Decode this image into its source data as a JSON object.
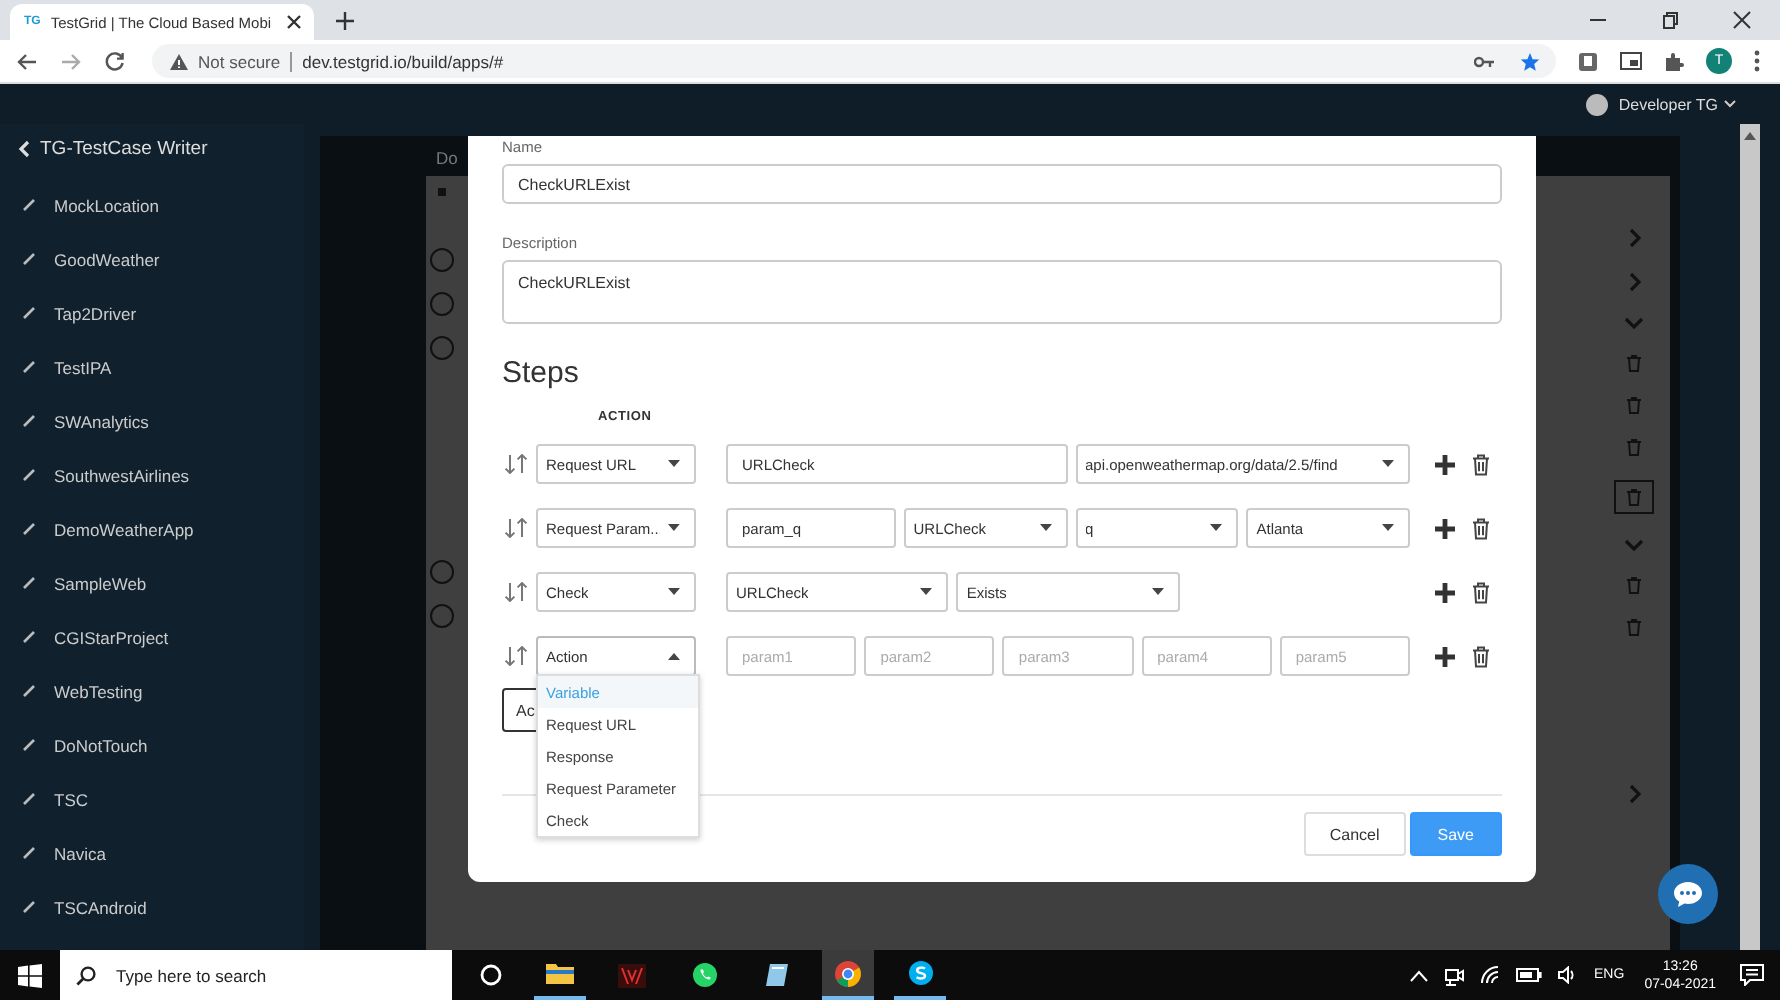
{
  "browser": {
    "favicon_text": "TG",
    "tab_title": "TestGrid | The Cloud Based Mobi",
    "security": "Not secure",
    "url": "dev.testgrid.io/build/apps/#",
    "profile_initial": "T"
  },
  "header": {
    "user": "Developer TG"
  },
  "sidebar": {
    "title": "TG-TestCase Writer",
    "items": [
      "MockLocation",
      "GoodWeather",
      "Tap2Driver",
      "TestIPA",
      "SWAnalytics",
      "SouthwestAirlines",
      "DemoWeatherApp",
      "SampleWeb",
      "CGIStarProject",
      "WebTesting",
      "DoNotTouch",
      "TSC",
      "Navica",
      "TSCAndroid"
    ]
  },
  "background": {
    "label": "Do"
  },
  "modal": {
    "name_label": "Name",
    "name_value": "CheckURLExist",
    "description_label": "Description",
    "description_value": "CheckURLExist",
    "steps_title": "Steps",
    "action_header": "ACTION",
    "steps": [
      {
        "action": "Request URL",
        "expanded": false,
        "fields": [
          {
            "kind": "input",
            "value": "URLCheck"
          },
          {
            "kind": "select",
            "value": "api.openweathermap.org/data/2.5/find"
          }
        ]
      },
      {
        "action": "Request Param...",
        "expanded": false,
        "fields": [
          {
            "kind": "input",
            "value": "param_q"
          },
          {
            "kind": "select",
            "value": "URLCheck"
          },
          {
            "kind": "select",
            "value": "q"
          },
          {
            "kind": "select",
            "value": "Atlanta"
          }
        ]
      },
      {
        "action": "Check",
        "expanded": false,
        "fields": [
          {
            "kind": "select",
            "value": "URLCheck"
          },
          {
            "kind": "select",
            "value": "Exists"
          }
        ]
      },
      {
        "action": "Action",
        "expanded": true,
        "options": [
          {
            "label": "Variable",
            "selected": true
          },
          {
            "label": "Request URL",
            "selected": false
          },
          {
            "label": "Response",
            "selected": false
          },
          {
            "label": "Request Parameter",
            "selected": false
          },
          {
            "label": "Check",
            "selected": false
          }
        ],
        "fields": [
          {
            "kind": "input",
            "placeholder": "param1"
          },
          {
            "kind": "input",
            "placeholder": "param2"
          },
          {
            "kind": "input",
            "placeholder": "param3"
          },
          {
            "kind": "input",
            "placeholder": "param4"
          },
          {
            "kind": "input",
            "placeholder": "param5"
          }
        ]
      }
    ],
    "add_step_button": "Ac",
    "cancel_button": "Cancel",
    "save_button": "Save"
  },
  "taskbar": {
    "search_placeholder": "Type here to search",
    "language": "ENG",
    "time": "13:26",
    "date": "07-04-2021"
  }
}
